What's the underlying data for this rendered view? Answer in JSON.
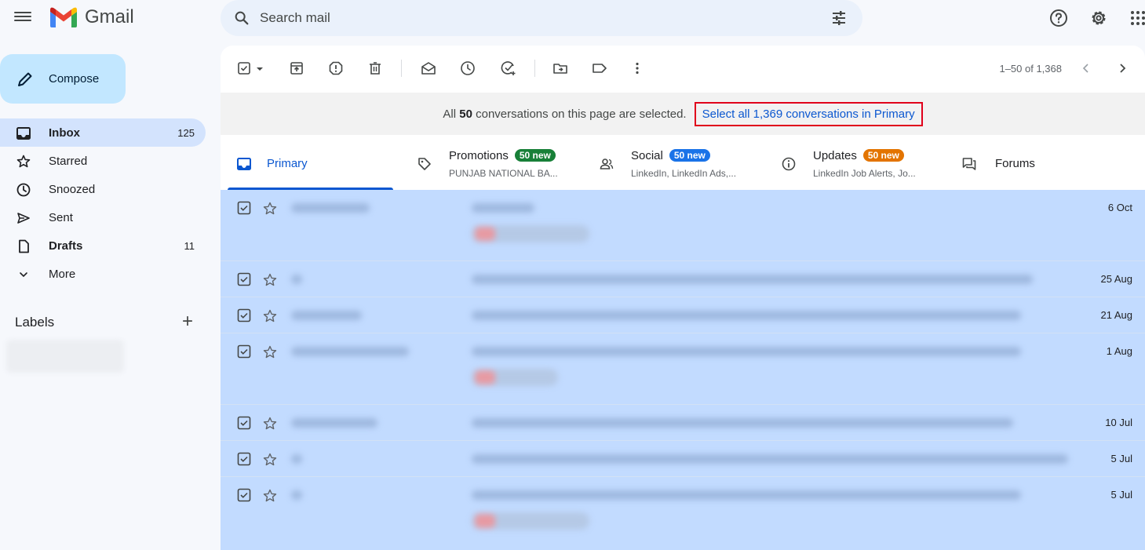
{
  "app": {
    "name": "Gmail",
    "search_placeholder": "Search mail"
  },
  "sidebar": {
    "compose_label": "Compose",
    "items": [
      {
        "label": "Inbox",
        "count": "125"
      },
      {
        "label": "Starred",
        "count": ""
      },
      {
        "label": "Snoozed",
        "count": ""
      },
      {
        "label": "Sent",
        "count": ""
      },
      {
        "label": "Drafts",
        "count": "11"
      },
      {
        "label": "More",
        "count": ""
      }
    ],
    "labels_heading": "Labels",
    "labels_add": "+"
  },
  "toolbar": {
    "paging": "1–50 of 1,368"
  },
  "banner": {
    "pre": "All ",
    "bold": "50",
    "post": " conversations on this page are selected.",
    "link": "Select all 1,369 conversations in Primary"
  },
  "tabs": {
    "primary": {
      "label": "Primary"
    },
    "promotions": {
      "label": "Promotions",
      "badge": "50 new",
      "badge_color": "#188038",
      "sub": "PUNJAB NATIONAL BA..."
    },
    "social": {
      "label": "Social",
      "badge": "50 new",
      "badge_color": "#1a73e8",
      "sub": "LinkedIn, LinkedIn Ads,..."
    },
    "updates": {
      "label": "Updates",
      "badge": "50 new",
      "badge_color": "#e37400",
      "sub": "LinkedIn Job Alerts, Jo..."
    },
    "forums": {
      "label": "Forums"
    }
  },
  "emails": [
    {
      "date": "6 Oct",
      "selected": true
    },
    {
      "date": "25 Aug",
      "selected": true
    },
    {
      "date": "21 Aug",
      "selected": true
    },
    {
      "date": "1 Aug",
      "selected": true
    },
    {
      "date": "10 Jul",
      "selected": true
    },
    {
      "date": "5 Jul",
      "selected": true
    },
    {
      "date": "5 Jul",
      "selected": true
    }
  ],
  "colors": {
    "accent": "#0b57d0",
    "compose_bg": "#c2e7ff",
    "selected_row_bg": "#c2dbff",
    "highlight_box": "#e0001b"
  }
}
